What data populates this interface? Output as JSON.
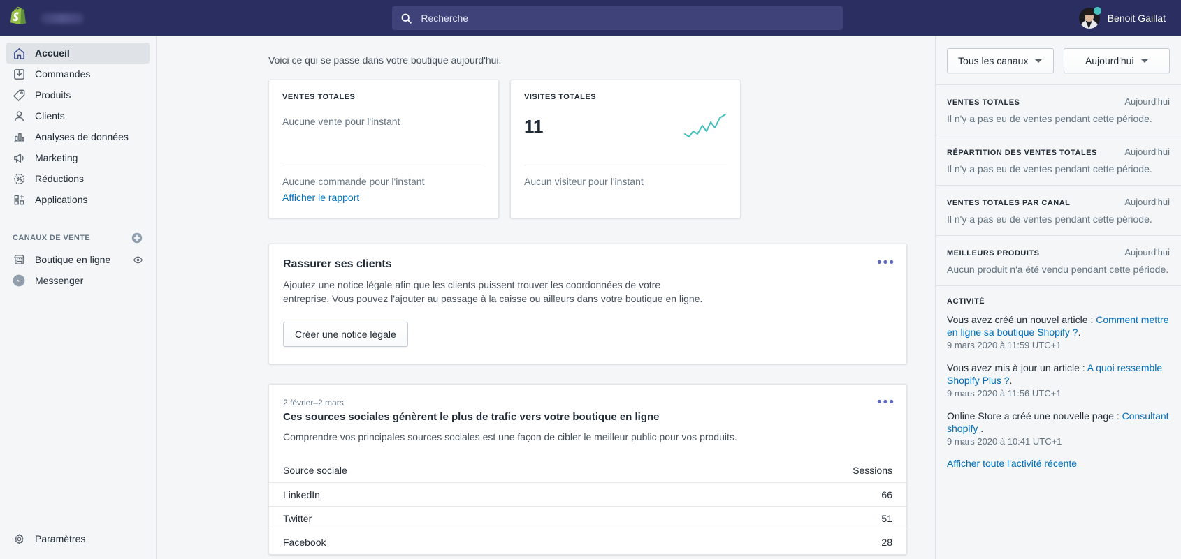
{
  "topbar": {
    "logo_icon": "shopify-bag-icon",
    "store_name_blurred": "",
    "search": {
      "icon": "search-icon",
      "placeholder": "Recherche",
      "value": ""
    },
    "user": {
      "name": "Benoit Gaillat",
      "avatar_icon": "user-avatar",
      "status": "online"
    }
  },
  "sidebar": {
    "nav": [
      {
        "label": "Accueil",
        "icon": "home-icon",
        "active": true
      },
      {
        "label": "Commandes",
        "icon": "orders-inbox-icon",
        "active": false
      },
      {
        "label": "Produits",
        "icon": "product-tag-icon",
        "active": false
      },
      {
        "label": "Clients",
        "icon": "customer-person-icon",
        "active": false
      },
      {
        "label": "Analyses de données",
        "icon": "analytics-bar-chart-icon",
        "active": false
      },
      {
        "label": "Marketing",
        "icon": "marketing-megaphone-icon",
        "active": false
      },
      {
        "label": "Réductions",
        "icon": "discount-percent-icon",
        "active": false
      },
      {
        "label": "Applications",
        "icon": "apps-grid-plus-icon",
        "active": false
      }
    ],
    "channels_section": {
      "title": "CANAUX DE VENTE",
      "add_icon": "plus-circle-icon",
      "items": [
        {
          "label": "Boutique en ligne",
          "icon": "storefront-icon",
          "action_icon": "eye-icon"
        },
        {
          "label": "Messenger",
          "icon": "messenger-icon",
          "action_icon": ""
        }
      ]
    },
    "settings": {
      "label": "Paramètres",
      "icon": "gear-icon"
    }
  },
  "main": {
    "greeting": "Voici ce qui se passe dans votre boutique aujourd'hui.",
    "metrics": [
      {
        "label": "VENTES TOTALES",
        "value": "",
        "empty_text": "Aucune vente pour l'instant",
        "sub_text": "Aucune commande pour l'instant",
        "link": "Afficher le rapport",
        "has_sparkline": false
      },
      {
        "label": "VISITES TOTALES",
        "value": "11",
        "empty_text": "",
        "sub_text": "Aucun visiteur pour l'instant",
        "link": "",
        "has_sparkline": true
      }
    ],
    "promo": {
      "title": "Rassurer ses clients",
      "text": "Ajoutez une notice légale afin que les clients puissent trouver les coordonnées de votre entreprise. Vous pouvez l'ajouter au passage à la caisse ou ailleurs dans votre boutique en ligne.",
      "button": "Créer une notice légale",
      "menu_icon": "ellipsis-icon"
    },
    "report": {
      "date_range": "2 février–2 mars",
      "title": "Ces sources sociales génèrent le plus de trafic vers votre boutique en ligne",
      "description": "Comprendre vos principales sources sociales est une façon de cibler le meilleur public pour vos produits.",
      "menu_icon": "ellipsis-icon",
      "columns": [
        "Source sociale",
        "Sessions"
      ],
      "rows": [
        {
          "source": "LinkedIn",
          "sessions": "66"
        },
        {
          "source": "Twitter",
          "sessions": "51"
        },
        {
          "source": "Facebook",
          "sessions": "28"
        }
      ]
    }
  },
  "rightpanel": {
    "filters": [
      {
        "label": "Tous les canaux",
        "icon": "chevron-down-icon"
      },
      {
        "label": "Aujourd'hui",
        "icon": "chevron-down-icon"
      }
    ],
    "blocks": [
      {
        "title": "VENTES TOTALES",
        "period": "Aujourd'hui",
        "body": "Il n'y a pas eu de ventes pendant cette période."
      },
      {
        "title": "RÉPARTITION DES VENTES TOTALES",
        "period": "Aujourd'hui",
        "body": "Il n'y a pas eu de ventes pendant cette période."
      },
      {
        "title": "VENTES TOTALES PAR CANAL",
        "period": "Aujourd'hui",
        "body": "Il n'y a pas eu de ventes pendant cette période."
      },
      {
        "title": "MEILLEURS PRODUITS",
        "period": "Aujourd'hui",
        "body": "Aucun produit n'a été vendu pendant cette période."
      }
    ],
    "activity": {
      "title": "ACTIVITÉ",
      "items": [
        {
          "prefix": "Vous avez créé un nouvel article : ",
          "link": "Comment mettre en ligne sa boutique Shopify ?",
          "suffix": ".",
          "time": "9 mars 2020 à 11:59 UTC+1"
        },
        {
          "prefix": "Vous avez mis à jour un article : ",
          "link": "A quoi ressemble Shopify Plus ?",
          "suffix": ".",
          "time": "9 mars 2020 à 11:56 UTC+1"
        },
        {
          "prefix": "Online Store a créé une nouvelle page : ",
          "link": "Consultant shopify",
          "suffix": " .",
          "time": "9 mars 2020 à 10:41 UTC+1"
        }
      ],
      "see_all": "Afficher toute l'activité récente"
    }
  },
  "chart_data": {
    "type": "line",
    "title": "Visites totales (sparkline)",
    "x": [
      1,
      2,
      3,
      4,
      5,
      6,
      7,
      8,
      9,
      10
    ],
    "values": [
      2,
      1,
      3,
      2,
      5,
      3,
      6,
      4,
      8,
      11
    ],
    "xlabel": "",
    "ylabel": "",
    "ylim": [
      0,
      12
    ],
    "color": "#47c1bf",
    "grid": false,
    "legend": "none"
  }
}
